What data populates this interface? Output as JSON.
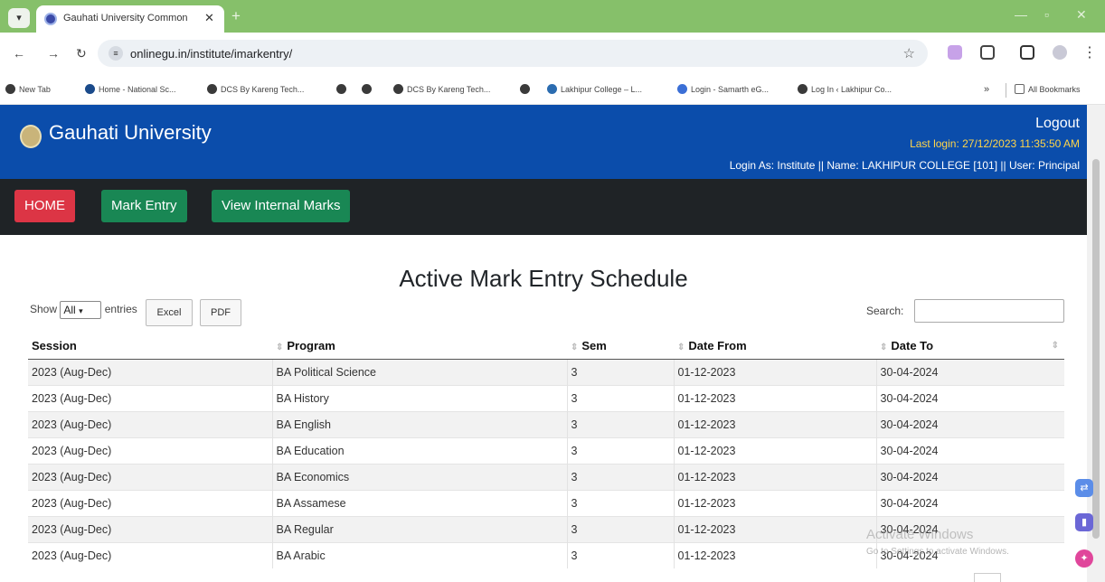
{
  "browser": {
    "tab_title": "Gauhati University Common A",
    "url": "onlinegu.in/institute/imarkentry/",
    "bookmarks": [
      "New Tab",
      "Home - National Sc...",
      "DCS By Kareng Tech...",
      "DCS By Kareng Tech...",
      "Lakhipur College – L...",
      "Login - Samarth eG...",
      "Log In ‹ Lakhipur Co..."
    ],
    "overflow": "»",
    "all_bookmarks": "All Bookmarks"
  },
  "header": {
    "brand": "Gauhati University",
    "logout": "Logout",
    "last_login": "Last login: 27/12/2023 11:35:50 AM",
    "login_as": "Login As: Institute || Name: LAKHIPUR COLLEGE [101] || User: Principal"
  },
  "menu": {
    "home": "HOME",
    "mark_entry": "Mark Entry",
    "view_internal": "View Internal Marks"
  },
  "main": {
    "title": "Active Mark Entry Schedule",
    "show_label": "Show",
    "show_value": "All",
    "entries_label": "entries",
    "excel": "Excel",
    "pdf": "PDF",
    "search_label": "Search:",
    "columns": [
      "Session",
      "Program",
      "Sem",
      "Date From",
      "Date To"
    ],
    "rows": [
      [
        "2023 (Aug-Dec)",
        "BA Political Science",
        "3",
        "01-12-2023",
        "30-04-2024"
      ],
      [
        "2023 (Aug-Dec)",
        "BA History",
        "3",
        "01-12-2023",
        "30-04-2024"
      ],
      [
        "2023 (Aug-Dec)",
        "BA English",
        "3",
        "01-12-2023",
        "30-04-2024"
      ],
      [
        "2023 (Aug-Dec)",
        "BA Education",
        "3",
        "01-12-2023",
        "30-04-2024"
      ],
      [
        "2023 (Aug-Dec)",
        "BA Economics",
        "3",
        "01-12-2023",
        "30-04-2024"
      ],
      [
        "2023 (Aug-Dec)",
        "BA Assamese",
        "3",
        "01-12-2023",
        "30-04-2024"
      ],
      [
        "2023 (Aug-Dec)",
        "BA Regular",
        "3",
        "01-12-2023",
        "30-04-2024"
      ],
      [
        "2023 (Aug-Dec)",
        "BA Arabic",
        "3",
        "01-12-2023",
        "30-04-2024"
      ]
    ]
  },
  "watermark": {
    "line1": "Activate Windows",
    "line2": "Go to Settings to activate Windows."
  },
  "colors": {
    "header_blue": "#0b4dab",
    "home_red": "#dc3545",
    "button_green": "#198754",
    "last_login_yellow": "#ffd54a"
  }
}
